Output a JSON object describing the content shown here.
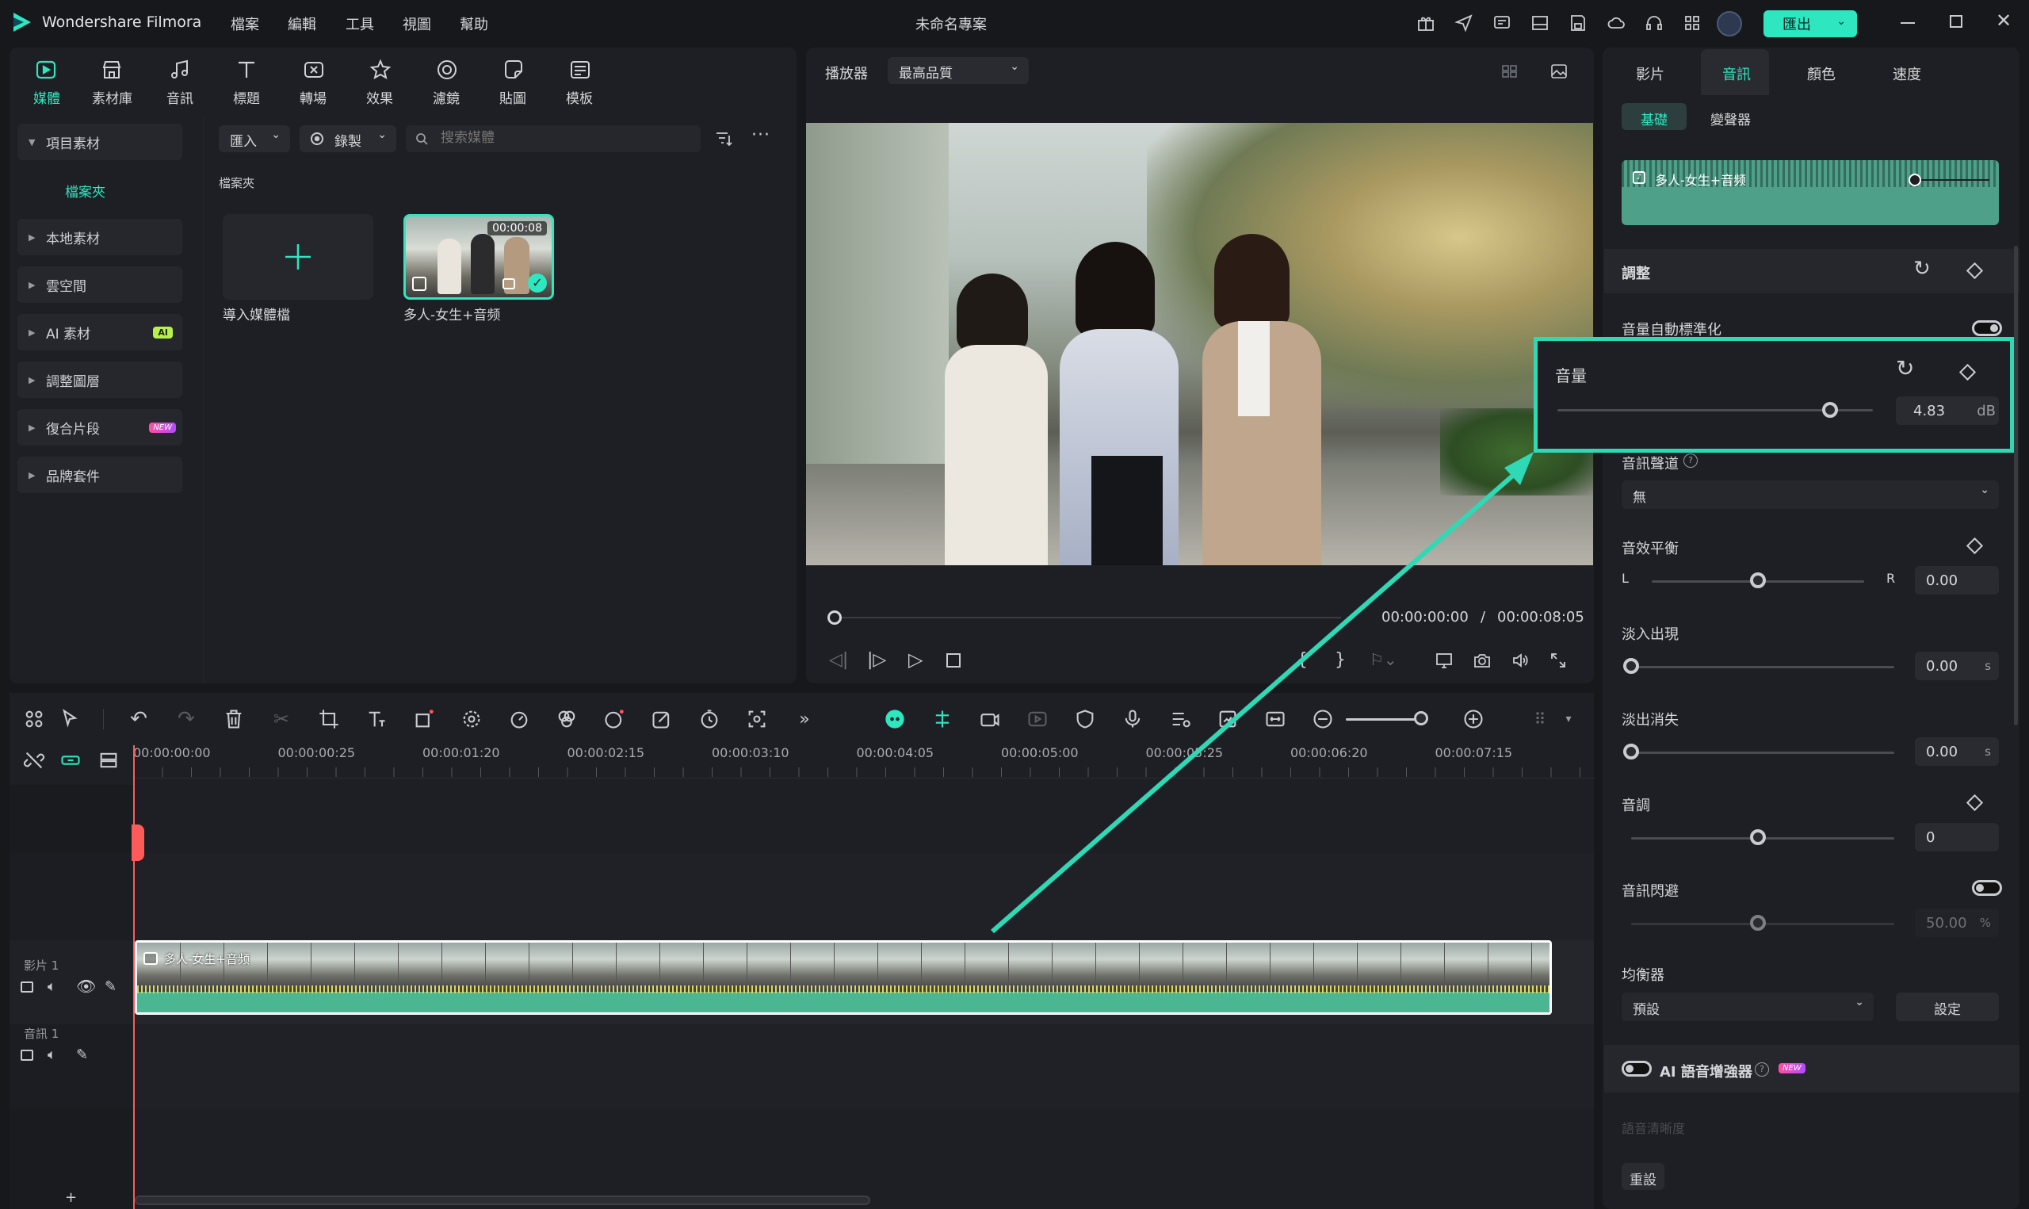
{
  "app": {
    "name": "Wondershare Filmora",
    "project_title": "未命名專案",
    "export_label": "匯出"
  },
  "menu": [
    "檔案",
    "編輯",
    "工具",
    "視圖",
    "幫助"
  ],
  "toolbar": [
    {
      "label": "媒體",
      "icon": "media-icon",
      "active": true
    },
    {
      "label": "素材庫",
      "icon": "stock-icon"
    },
    {
      "label": "音訊",
      "icon": "audio-icon"
    },
    {
      "label": "標題",
      "icon": "title-icon"
    },
    {
      "label": "轉場",
      "icon": "transition-icon"
    },
    {
      "label": "效果",
      "icon": "effects-icon"
    },
    {
      "label": "濾鏡",
      "icon": "filter-icon"
    },
    {
      "label": "貼圖",
      "icon": "sticker-icon"
    },
    {
      "label": "模板",
      "icon": "template-icon"
    }
  ],
  "sidebar": {
    "project_label": "項目素材",
    "folder_label": "檔案夾",
    "items": [
      {
        "label": "本地素材"
      },
      {
        "label": "雲空間"
      },
      {
        "label": "AI 素材",
        "badge": "AI"
      },
      {
        "label": "調整圖層"
      },
      {
        "label": "復合片段",
        "badge": "NEW"
      },
      {
        "label": "品牌套件"
      }
    ]
  },
  "media": {
    "import_label": "匯入",
    "record_label": "錄製",
    "search_placeholder": "搜索媒體",
    "folder_heading": "檔案夾",
    "import_card_label": "導入媒體檔",
    "clip_name": "多人-女生+音频",
    "clip_duration": "00:00:08"
  },
  "player": {
    "label": "播放器",
    "quality": "最高品質",
    "current_time": "00:00:00:00",
    "separator": "/",
    "total_time": "00:00:08:05"
  },
  "inspector": {
    "tabs": [
      "影片",
      "音訊",
      "顏色",
      "速度"
    ],
    "active_tab": "音訊",
    "subtabs": [
      "基礎",
      "變聲器"
    ],
    "active_subtab": "基礎",
    "clip_name": "多人-女生+音频",
    "adjust_heading": "調整",
    "auto_normalize_label": "音量自動標準化",
    "volume": {
      "label": "音量",
      "value": "4.83",
      "unit": "dB",
      "level": 0.86
    },
    "channel": {
      "label": "音訊聲道",
      "value": "無"
    },
    "balance": {
      "label": "音效平衡",
      "left": "L",
      "right": "R",
      "value": "0.00",
      "level": 0.5
    },
    "fade_in": {
      "label": "淡入出現",
      "value": "0.00",
      "unit": "s",
      "level": 0.0
    },
    "fade_out": {
      "label": "淡出消失",
      "value": "0.00",
      "unit": "s",
      "level": 0.0
    },
    "pitch": {
      "label": "音調",
      "value": "0",
      "level": 0.5
    },
    "ducking": {
      "label": "音訊閃避",
      "value": "50.00",
      "unit": "%",
      "level": 0.5
    },
    "equalizer": {
      "label": "均衡器",
      "value": "預設",
      "settings_label": "設定"
    },
    "ai_enhancer": {
      "label": "AI 語音增強器",
      "badge": "NEW"
    },
    "clarity_label": "語音清晰度",
    "reset_label": "重設"
  },
  "timeline": {
    "ruler": [
      "00:00:00:00",
      "00:00:00:25",
      "00:00:01:20",
      "00:00:02:15",
      "00:00:03:10",
      "00:00:04:05",
      "00:00:05:00",
      "00:00:05:25",
      "00:00:06:20",
      "00:00:07:15"
    ],
    "video_track_label": "影片 1",
    "audio_track_label": "音訊 1",
    "clip_label": "多人-女生+音频"
  },
  "colors": {
    "accent": "#35e0b7",
    "export_bg": "#2ee6c0",
    "highlight": "#2fd9b5"
  }
}
